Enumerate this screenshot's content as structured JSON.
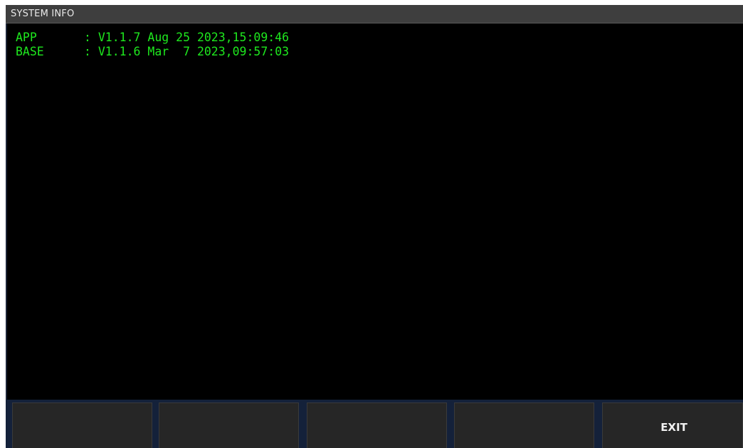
{
  "window": {
    "title": "SYSTEM INFO"
  },
  "info": {
    "rows": [
      {
        "label": "APP",
        "value": ": V1.1.7 Aug 25 2023,15:09:46"
      },
      {
        "label": "BASE",
        "value": ": V1.1.6 Mar  7 2023,09:57:03"
      }
    ]
  },
  "softkeys": [
    {
      "label": ""
    },
    {
      "label": ""
    },
    {
      "label": ""
    },
    {
      "label": ""
    },
    {
      "label": "EXIT"
    }
  ],
  "colors": {
    "background": "#000000",
    "text_green": "#1ee81e",
    "title_bar": "#3e3e3e",
    "softkey": "#262626",
    "softkey_bar": "#14213a"
  }
}
